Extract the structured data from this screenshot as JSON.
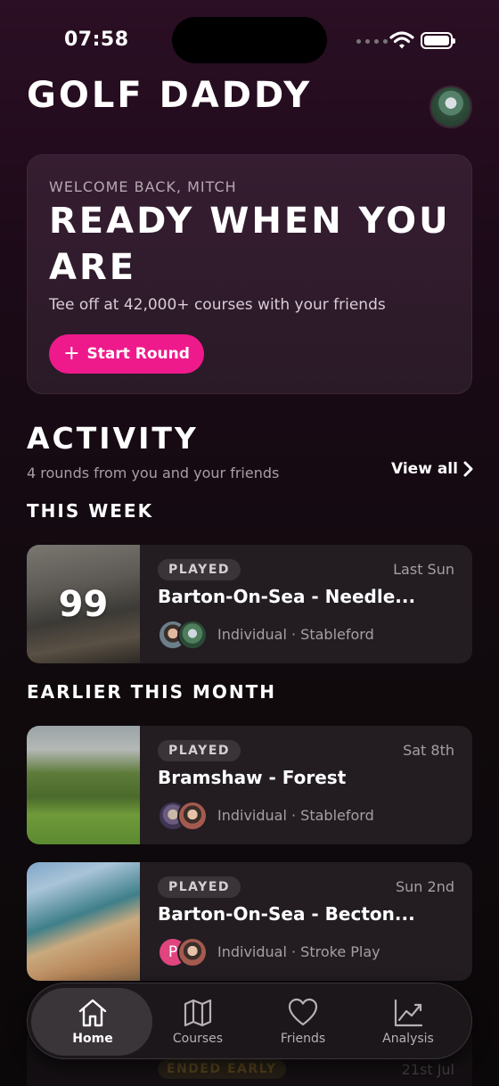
{
  "status_bar": {
    "time": "07:58"
  },
  "header": {
    "title": "GOLF DADDY"
  },
  "hero": {
    "welcome": "WELCOME BACK, MITCH",
    "headline": "READY WHEN YOU ARE",
    "subtitle": "Tee off at 42,000+ courses with your friends",
    "start_button": "Start Round"
  },
  "activity": {
    "title": "ACTIVITY",
    "subtitle": "4 rounds from you and your friends",
    "view_all": "View all",
    "groups": [
      {
        "label": "THIS WEEK"
      },
      {
        "label": "EARLIER THIS MONTH"
      }
    ],
    "rounds": [
      {
        "status": "PLAYED",
        "date": "Last Sun",
        "course": "Barton-On-Sea - Needle...",
        "meta": "Individual · Stableford",
        "score": "99"
      },
      {
        "status": "PLAYED",
        "date": "Sat 8th",
        "course": "Bramshaw - Forest",
        "meta": "Individual · Stableford"
      },
      {
        "status": "PLAYED",
        "date": "Sun 2nd",
        "course": "Barton-On-Sea - Becton...",
        "meta": "Individual · Stroke Play",
        "avatar_initial": "P"
      },
      {
        "status": "ENDED EARLY",
        "date": "21st Jul"
      }
    ]
  },
  "tabbar": {
    "tabs": [
      {
        "label": "Home",
        "icon": "home-icon",
        "active": true
      },
      {
        "label": "Courses",
        "icon": "map-icon"
      },
      {
        "label": "Friends",
        "icon": "heart-icon"
      },
      {
        "label": "Analysis",
        "icon": "chart-icon"
      }
    ]
  },
  "colors": {
    "accent": "#ee1a8c",
    "card": "#231d22",
    "background": "#0b0809"
  }
}
